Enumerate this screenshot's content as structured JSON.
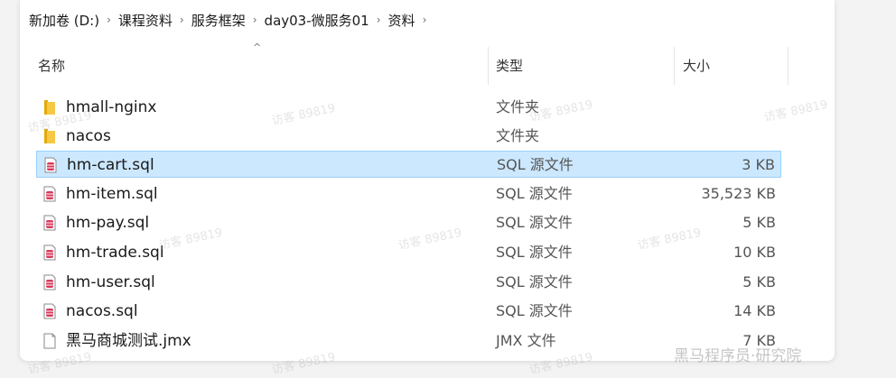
{
  "breadcrumb": {
    "items": [
      "新加卷 (D:)",
      "课程资料",
      "服务框架",
      "day03-微服务01",
      "资料"
    ],
    "separator": "›"
  },
  "columns": {
    "name": "名称",
    "type": "类型",
    "size": "大小"
  },
  "files": [
    {
      "name": "hmall-nginx",
      "type": "文件夹",
      "size": "",
      "icon": "folder-icon"
    },
    {
      "name": "nacos",
      "type": "文件夹",
      "size": "",
      "icon": "folder-icon"
    },
    {
      "name": "hm-cart.sql",
      "type": "SQL 源文件",
      "size": "3 KB",
      "icon": "sql-file-icon",
      "selected": true
    },
    {
      "name": "hm-item.sql",
      "type": "SQL 源文件",
      "size": "35,523 KB",
      "icon": "sql-file-icon"
    },
    {
      "name": "hm-pay.sql",
      "type": "SQL 源文件",
      "size": "5 KB",
      "icon": "sql-file-icon"
    },
    {
      "name": "hm-trade.sql",
      "type": "SQL 源文件",
      "size": "10 KB",
      "icon": "sql-file-icon"
    },
    {
      "name": "hm-user.sql",
      "type": "SQL 源文件",
      "size": "5 KB",
      "icon": "sql-file-icon"
    },
    {
      "name": "nacos.sql",
      "type": "SQL 源文件",
      "size": "14 KB",
      "icon": "sql-file-icon"
    },
    {
      "name": "黑马商城测试.jmx",
      "type": "JMX 文件",
      "size": "7 KB",
      "icon": "blank-file-icon"
    }
  ],
  "watermark": {
    "text": "访客 89819",
    "brand": "黑马程序员·研究院"
  },
  "colors": {
    "selection": "#cce8ff",
    "folder": "#f4c430",
    "sql_icon": "#d9395b"
  }
}
